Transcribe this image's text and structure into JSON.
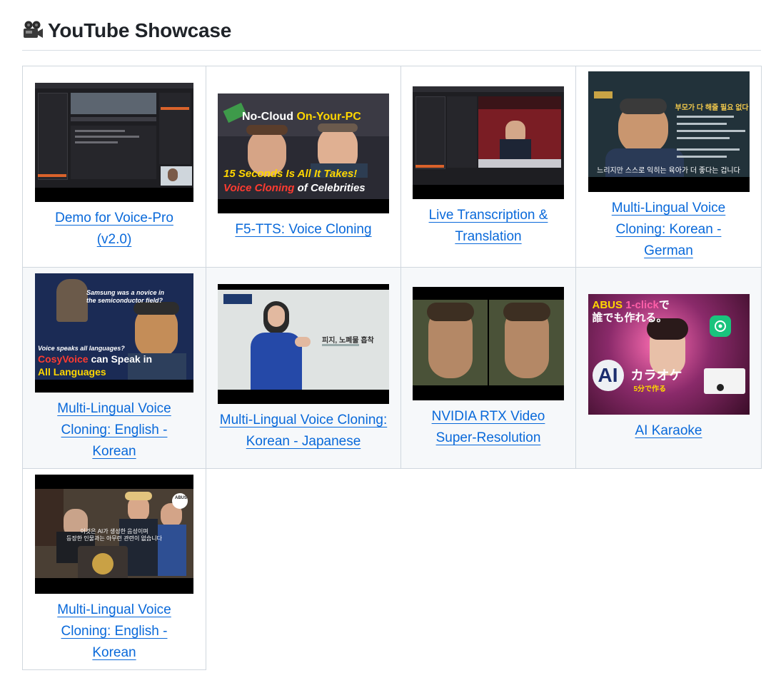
{
  "heading": {
    "icon": "film-camera-icon",
    "title": "YouTube Showcase"
  },
  "videos": [
    {
      "caption": "Demo for Voice-Pro (v2.0)"
    },
    {
      "caption": "F5-TTS: Voice Cloning",
      "thumb": {
        "line1": "No-Cloud",
        "line1b": "On-Your-PC",
        "line2": "15 Seconds Is All It Takes!",
        "line3a": "Voice Cloning",
        "line3b": "of Celebrities"
      }
    },
    {
      "caption": "Live Transcription & Translation"
    },
    {
      "caption": "Multi-Lingual Voice Cloning: Korean - German",
      "thumb": {
        "title": "부모가 다 해줄 필요 없다",
        "subtitle": "느리지만 스스로 익히는 육아가 더 좋다는 겁니다"
      }
    },
    {
      "caption": "Multi-Lingual Voice Cloning: English - Korean",
      "thumb": {
        "top": "Samsung was a novice in the semiconductor field?",
        "q": "Voice speaks all languages?",
        "l1a": "CosyVoice",
        "l1b": "can Speak in",
        "l2": "All Languages"
      }
    },
    {
      "caption": "Multi-Lingual Voice Cloning: Korean - Japanese",
      "thumb": {
        "label": "피지, 노폐물 흡착"
      }
    },
    {
      "caption": "NVIDIA RTX Video Super-Resolution"
    },
    {
      "caption": "AI Karaoke",
      "thumb": {
        "l1a": "ABUS",
        "l1b": "1-click",
        "l1c": "で",
        "l2": "誰でも作れる。",
        "ai": "AI",
        "kara": "カラオケ",
        "sub": "5分で作る"
      }
    },
    {
      "caption": "Multi-Lingual Voice Cloning: English - Korean",
      "thumb": {
        "sub1": "이것은 AI가 생성한 음성이며",
        "sub2": "등장한 인물과는 아무런 관련이 없습니다",
        "logo": "ABUS"
      }
    }
  ]
}
